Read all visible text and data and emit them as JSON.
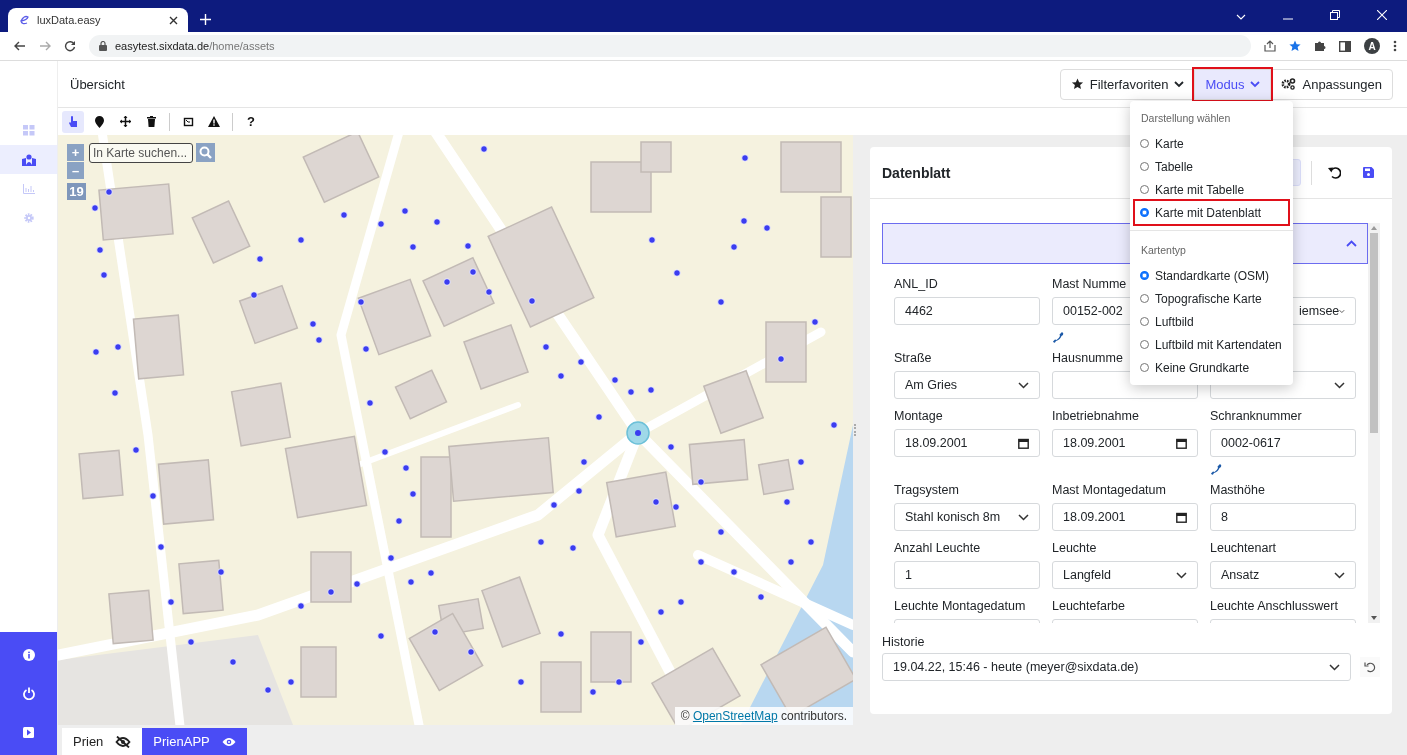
{
  "browser": {
    "tab_title": "luxData.easy",
    "url_host": "easytest.sixdata.de",
    "url_path": "/home/assets",
    "profile_initial": "A"
  },
  "sidebar": {
    "items": [
      {
        "selected": false
      },
      {
        "selected": true
      },
      {
        "selected": false
      },
      {
        "selected": false
      }
    ]
  },
  "header": {
    "title": "Übersicht",
    "buttons": [
      {
        "label": "Filterfavoriten",
        "selected": false,
        "highlighted": false
      },
      {
        "label": "Modus",
        "selected": true,
        "highlighted": true
      },
      {
        "label": "Anpassungen",
        "selected": false,
        "highlighted": false
      }
    ]
  },
  "toolbar": {
    "tools": [
      {
        "selected": true
      },
      {
        "selected": false
      },
      {
        "selected": false
      },
      {
        "selected": false
      },
      {
        "selected": false
      },
      {
        "selected": false
      }
    ],
    "help": "?"
  },
  "map": {
    "search_placeholder": "In Karte suchen...",
    "zoom_in": "+",
    "zoom_out": "–",
    "zoom_level": "19",
    "attribution_prefix": "©",
    "attribution_link": "OpenStreetMap",
    "attribution_suffix": "contributors."
  },
  "panel": {
    "title": "Datenblatt",
    "fields": [
      {
        "kind": "text",
        "label": "ANL_ID",
        "value": "4462",
        "phone": false
      },
      {
        "kind": "text",
        "label": "Mast Numme",
        "value": "00152-002",
        "phone": true
      },
      {
        "kind": "select",
        "value": "iemsee",
        "phone": false
      },
      {
        "kind": "select",
        "label": "Straße",
        "value": "Am Gries",
        "phone": false
      },
      {
        "kind": "text",
        "label": "Hausnumme",
        "phone": false
      },
      {
        "kind": "select",
        "phone": false
      },
      {
        "kind": "date",
        "label": "Montage",
        "value": "18.09.2001",
        "phone": false
      },
      {
        "kind": "date",
        "label": "Inbetriebnahme",
        "value": "18.09.2001",
        "phone": false
      },
      {
        "kind": "text",
        "label": "Schranknummer",
        "value": "0002-0617",
        "phone": true
      },
      {
        "kind": "select",
        "label": "Tragsystem",
        "value": "Stahl konisch 8m",
        "phone": false
      },
      {
        "kind": "date",
        "label": "Mast Montagedatum",
        "value": "18.09.2001",
        "phone": false
      },
      {
        "kind": "text",
        "label": "Masthöhe",
        "value": "8",
        "phone": false
      },
      {
        "kind": "text",
        "label": "Anzahl Leuchte",
        "value": "1",
        "phone": false
      },
      {
        "kind": "select",
        "label": "Leuchte",
        "value": "Langfeld",
        "phone": false
      },
      {
        "kind": "select",
        "label": "Leuchtenart",
        "value": "Ansatz",
        "phone": false
      },
      {
        "kind": "date",
        "label": "Leuchte Montagedatum",
        "phone": false
      },
      {
        "kind": "text",
        "label": "Leuchtefarbe",
        "phone": false
      },
      {
        "kind": "text",
        "label": "Leuchte Anschlusswert",
        "phone": false
      }
    ],
    "history": {
      "label": "Historie",
      "value": "19.04.22, 15:46 - heute (meyer@sixdata.de)"
    }
  },
  "menu": {
    "sections": [
      {
        "heading": "Darstellung wählen",
        "options": [
          {
            "label": "Karte",
            "selected": false,
            "highlighted": false
          },
          {
            "label": "Tabelle",
            "selected": false,
            "highlighted": false
          },
          {
            "label": "Karte mit Tabelle",
            "selected": false,
            "highlighted": false
          },
          {
            "label": "Karte mit Datenblatt",
            "selected": true,
            "highlighted": true
          }
        ]
      },
      {
        "heading": "Kartentyp",
        "options": [
          {
            "label": "Standardkarte (OSM)",
            "selected": true,
            "highlighted": false
          },
          {
            "label": "Topografische Karte",
            "selected": false,
            "highlighted": false
          },
          {
            "label": "Luftbild",
            "selected": false,
            "highlighted": false
          },
          {
            "label": "Luftbild mit Kartendaten",
            "selected": false,
            "highlighted": false
          },
          {
            "label": "Keine Grundkarte",
            "selected": false,
            "highlighted": false
          }
        ]
      }
    ]
  },
  "bottom_tabs": [
    {
      "label": "Prien",
      "selected": false,
      "visible": false
    },
    {
      "label": "PrienAPP",
      "selected": true,
      "visible": true
    }
  ]
}
